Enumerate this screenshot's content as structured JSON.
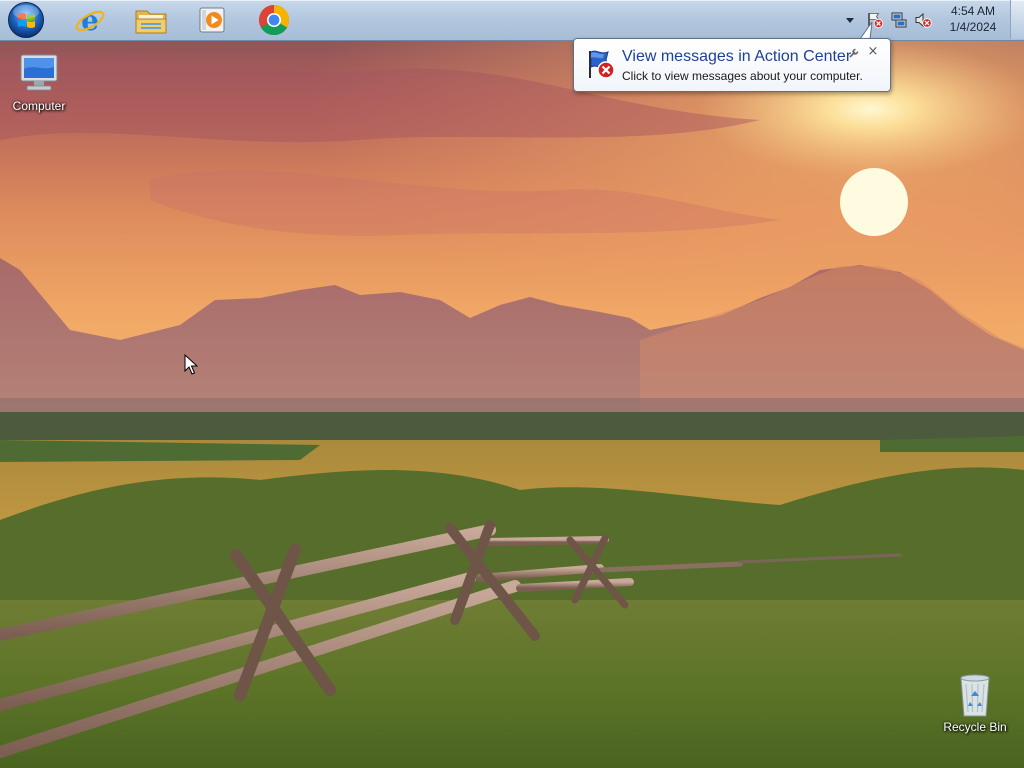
{
  "taskbar": {
    "start": {
      "icon": "windows-orb-icon"
    },
    "pinned": [
      {
        "name": "internet-explorer",
        "icon": "internet-explorer-icon"
      },
      {
        "name": "windows-explorer",
        "icon": "folder-icon"
      },
      {
        "name": "media-player",
        "icon": "media-player-icon"
      },
      {
        "name": "google-chrome",
        "icon": "chrome-icon"
      }
    ],
    "tray": {
      "icons": [
        "action-center-flag-icon",
        "network-icon",
        "volume-muted-icon"
      ],
      "clock": {
        "time": "4:54 AM",
        "date": "1/4/2024"
      }
    }
  },
  "balloon": {
    "title": "View messages in Action Center",
    "text": "Click to view messages about your computer.",
    "close_glyph": "×"
  },
  "desktop": {
    "icons": [
      {
        "label": "Computer",
        "icon": "computer-icon"
      },
      {
        "label": "Recycle Bin",
        "icon": "recycle-bin-icon"
      }
    ],
    "wallpaper": "mountain-sunset-with-fence",
    "colors": {
      "sky_top": "#8a4a52",
      "sun": "#fff6c8",
      "grass": "#6b7d2e"
    }
  }
}
